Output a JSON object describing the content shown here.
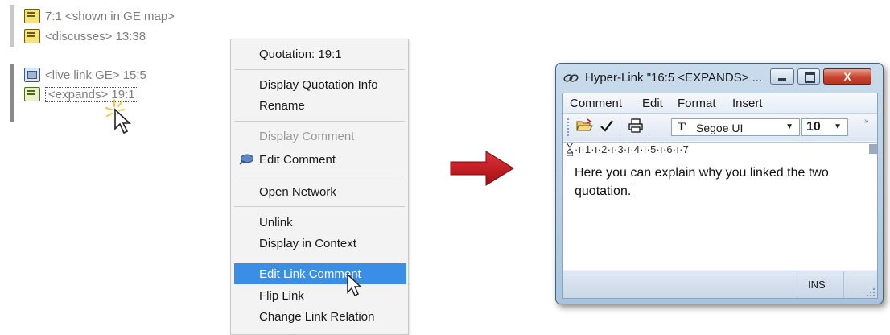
{
  "links_panel": {
    "items": [
      {
        "text": "7:1 <shown in GE map>",
        "icon": "quotation-icon"
      },
      {
        "text": "<discusses> 13:38",
        "icon": "quotation-icon"
      },
      {
        "text": "<live link GE> 15:5",
        "icon": "live-link-icon"
      },
      {
        "text": "<expands> 19:1",
        "icon": "hyperlink-icon"
      }
    ]
  },
  "context_menu": {
    "header": "Quotation: 19:1",
    "items": {
      "display_quotation_info": "Display Quotation Info",
      "rename": "Rename",
      "display_comment": "Display Comment",
      "edit_comment": "Edit Comment",
      "open_network": "Open Network",
      "unlink": "Unlink",
      "display_in_context": "Display in Context",
      "edit_link_comment": "Edit Link Comment",
      "flip_link": "Flip Link",
      "change_link_relation": "Change Link Relation"
    },
    "highlighted": "Edit Link Comment",
    "disabled": [
      "Display Comment"
    ]
  },
  "dialog": {
    "title": "Hyper-Link \"16:5 <EXPANDS> ...",
    "close_glyph": "X",
    "menu": [
      "Comment",
      "Edit",
      "Format",
      "Insert"
    ],
    "font_name": "Segoe UI",
    "font_glyph": "T",
    "font_size": "10",
    "ruler_text": "·ı·1·ı·2·ı·3·ı·4·ı·5·ı·6·ı·7",
    "content": "Here you can explain why you linked the two quotation.",
    "status_mode": "INS"
  },
  "colors": {
    "menu_highlight": "#3a8ee6",
    "arrow": "#c0141a",
    "close_button": "#c8432d"
  }
}
